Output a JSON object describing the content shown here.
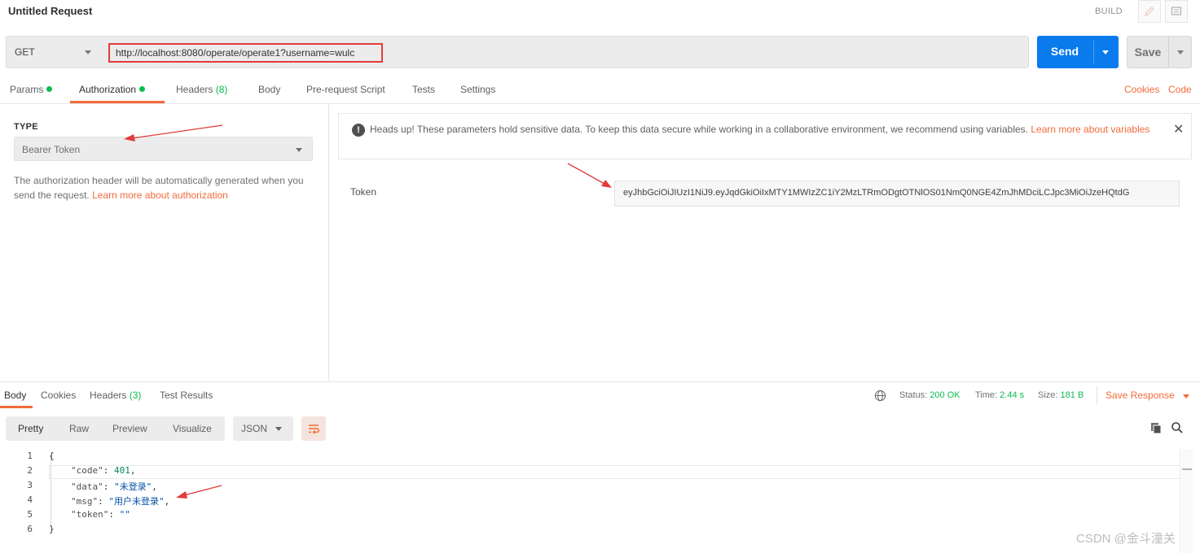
{
  "header": {
    "title": "Untitled Request",
    "build_label": "BUILD",
    "edit_icon": "pencil-icon",
    "comment_icon": "comment-icon"
  },
  "request": {
    "method": "GET",
    "url": "http://localhost:8080/operate/operate1?username=wulc",
    "send_label": "Send",
    "save_label": "Save"
  },
  "request_tabs": {
    "params": "Params",
    "authorization": "Authorization",
    "headers": "Headers",
    "headers_count": "(8)",
    "body": "Body",
    "prerequest": "Pre-request Script",
    "tests": "Tests",
    "settings": "Settings",
    "cookies_link": "Cookies",
    "code_link": "Code"
  },
  "auth": {
    "type_label": "TYPE",
    "type_value": "Bearer Token",
    "description": "The authorization header will be automatically generated when you send the request.",
    "learn_more": "Learn more about authorization",
    "alert_text": "Heads up! These parameters hold sensitive data. To keep this data secure while working in a collaborative environment, we recommend using variables.",
    "alert_link": "Learn more about variables",
    "token_label": "Token",
    "token_value": "eyJhbGciOiJIUzI1NiJ9.eyJqdGkiOiIxMTY1MWIzZC1iY2MzLTRmODgtOTNlOS01NmQ0NGE4ZmJhMDciLCJpc3MiOiJzeHQtdG"
  },
  "response_tabs": {
    "body": "Body",
    "cookies": "Cookies",
    "headers": "Headers",
    "headers_count": "(3)",
    "test_results": "Test Results"
  },
  "response_status": {
    "status_label": "Status:",
    "status_value": "200 OK",
    "time_label": "Time:",
    "time_value": "2.44 s",
    "size_label": "Size:",
    "size_value": "181 B",
    "save_response": "Save Response"
  },
  "viewer": {
    "modes": [
      "Pretty",
      "Raw",
      "Preview",
      "Visualize"
    ],
    "format": "JSON"
  },
  "body_lines": {
    "open": "{",
    "code_key": "\"code\"",
    "code_val": "401",
    "data_key": "\"data\"",
    "data_val": "\"未登录\"",
    "msg_key": "\"msg\"",
    "msg_val": "\"用户未登录\"",
    "token_key": "\"token\"",
    "token_val": "\"\"",
    "close": "}",
    "line_numbers": [
      "1",
      "2",
      "3",
      "4",
      "5",
      "6"
    ]
  },
  "watermark": "CSDN @金斗潼关",
  "colors": {
    "accent": "#f26b3a",
    "send": "#097bed",
    "success": "#0cbb52",
    "annotation": "#e23b3b"
  }
}
